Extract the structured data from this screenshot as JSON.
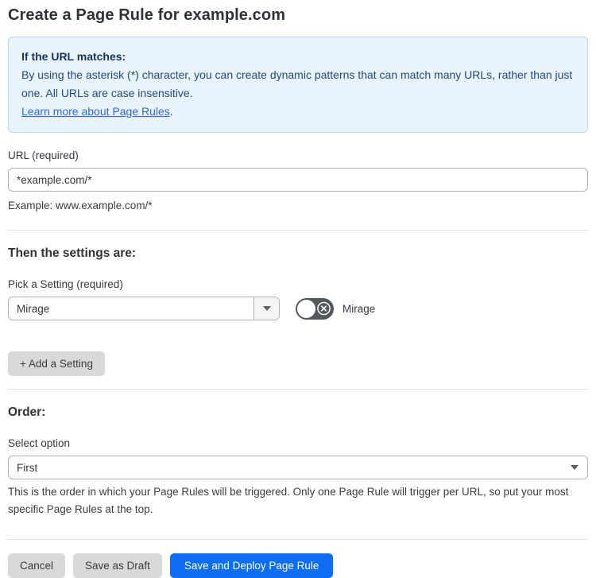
{
  "page": {
    "title": "Create a Page Rule for example.com"
  },
  "info_box": {
    "heading": "If the URL matches:",
    "body": "By using the asterisk (*) character, you can create dynamic patterns that can match many URLs, rather than just one. All URLs are case insensitive.",
    "link_label": "Learn more about Page Rules",
    "link_suffix": "."
  },
  "url_field": {
    "label": "URL (required)",
    "value": "*example.com/*",
    "helper": "Example: www.example.com/*"
  },
  "settings_section": {
    "heading": "Then the settings are:",
    "setting_label": "Pick a Setting (required)",
    "setting_value": "Mirage",
    "toggle": {
      "state": "off",
      "label": "Mirage"
    },
    "add_button_label": "+ Add a Setting"
  },
  "order_section": {
    "heading": "Order:",
    "label": "Select option",
    "value": "First",
    "helper": "This is the order in which your Page Rules will be triggered. Only one Page Rule will trigger per URL, so put your most specific Page Rules at the top."
  },
  "footer": {
    "cancel_label": "Cancel",
    "save_draft_label": "Save as Draft",
    "deploy_label": "Save and Deploy Page Rule"
  },
  "colors": {
    "accent_blue": "#0d6ef4",
    "info_background": "#e9f3fc",
    "info_border": "#b9d7f3",
    "info_text": "#244a7d",
    "info_heading": "#16365e",
    "link_blue": "#2f6bd8",
    "toggle_off": "#54575e",
    "button_gray": "#d9d9d9"
  }
}
